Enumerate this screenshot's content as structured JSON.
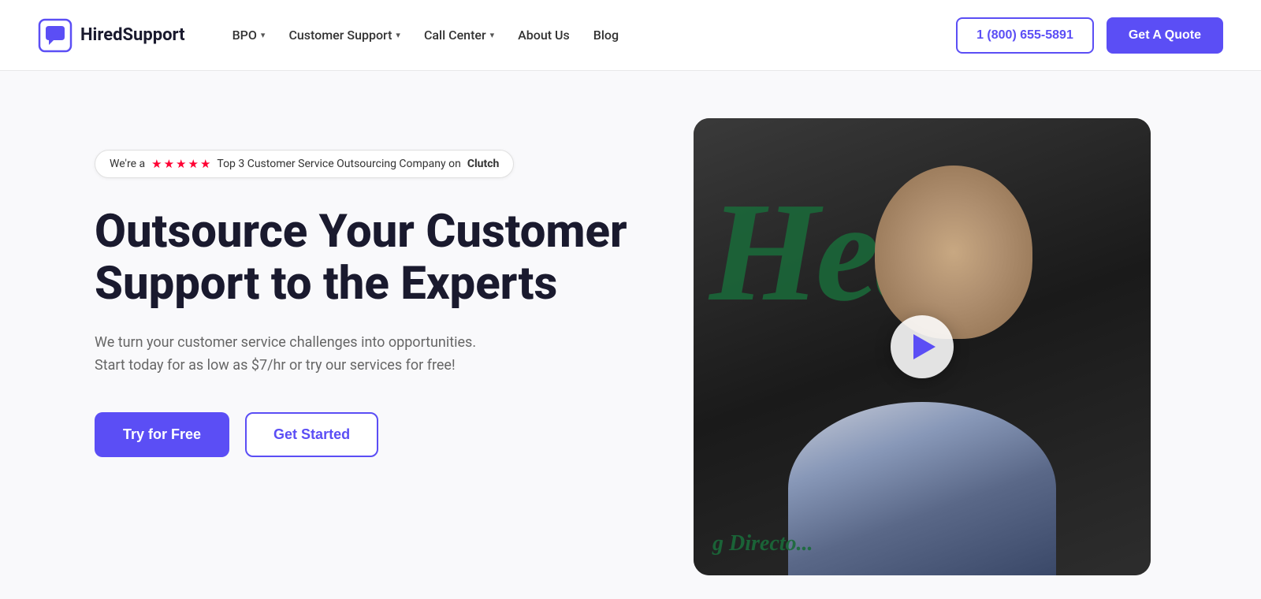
{
  "brand": {
    "name": "HiredSupport",
    "logo_icon": "chat-icon"
  },
  "navbar": {
    "links": [
      {
        "label": "BPO",
        "has_dropdown": true
      },
      {
        "label": "Customer Support",
        "has_dropdown": true
      },
      {
        "label": "Call Center",
        "has_dropdown": true
      },
      {
        "label": "About Us",
        "has_dropdown": false
      },
      {
        "label": "Blog",
        "has_dropdown": false
      }
    ],
    "phone": "1 (800) 655-5891",
    "cta_label": "Get A Quote"
  },
  "hero": {
    "badge_prefix": "We're a",
    "badge_suffix": "Top 3 Customer Service Outsourcing Company on",
    "badge_brand": "Clutch",
    "title": "Outsource Your Customer Support to the Experts",
    "subtitle": "We turn your customer service challenges into opportunities. Start today for as low as $7/hr or try our services for free!",
    "btn_primary": "Try for Free",
    "btn_secondary": "Get Started",
    "video_bg_text": "Healt",
    "video_bottom_text": "g Directo..."
  }
}
